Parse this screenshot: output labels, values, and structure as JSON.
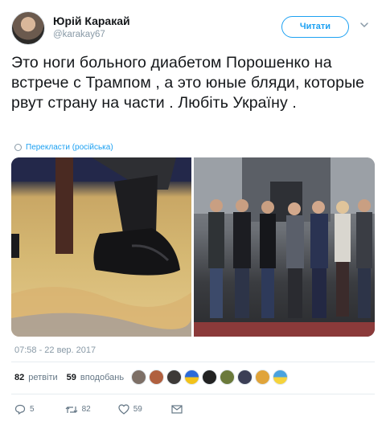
{
  "header": {
    "display_name": "Юрій Каракай",
    "handle": "@karakay67",
    "follow_label": "Читати"
  },
  "tweet": {
    "text": "Это ноги больного диабетом  Порошенко на встрече с Трампом , а это юные бляди, которые рвут страну на части . Любіть Україну .",
    "translate_label": "Перекласти (російська)",
    "timestamp": "07:58 - 22 вер. 2017"
  },
  "stats": {
    "retweets_count": "82",
    "retweets_label": "ретвіти",
    "likes_count": "59",
    "likes_label": "вподобань"
  },
  "actions": {
    "reply_count": "5",
    "retweet_count": "82",
    "like_count": "59"
  },
  "colors": {
    "accent": "#1da1f2",
    "secondary_text": "#8899a6",
    "primary_text": "#14171a"
  }
}
